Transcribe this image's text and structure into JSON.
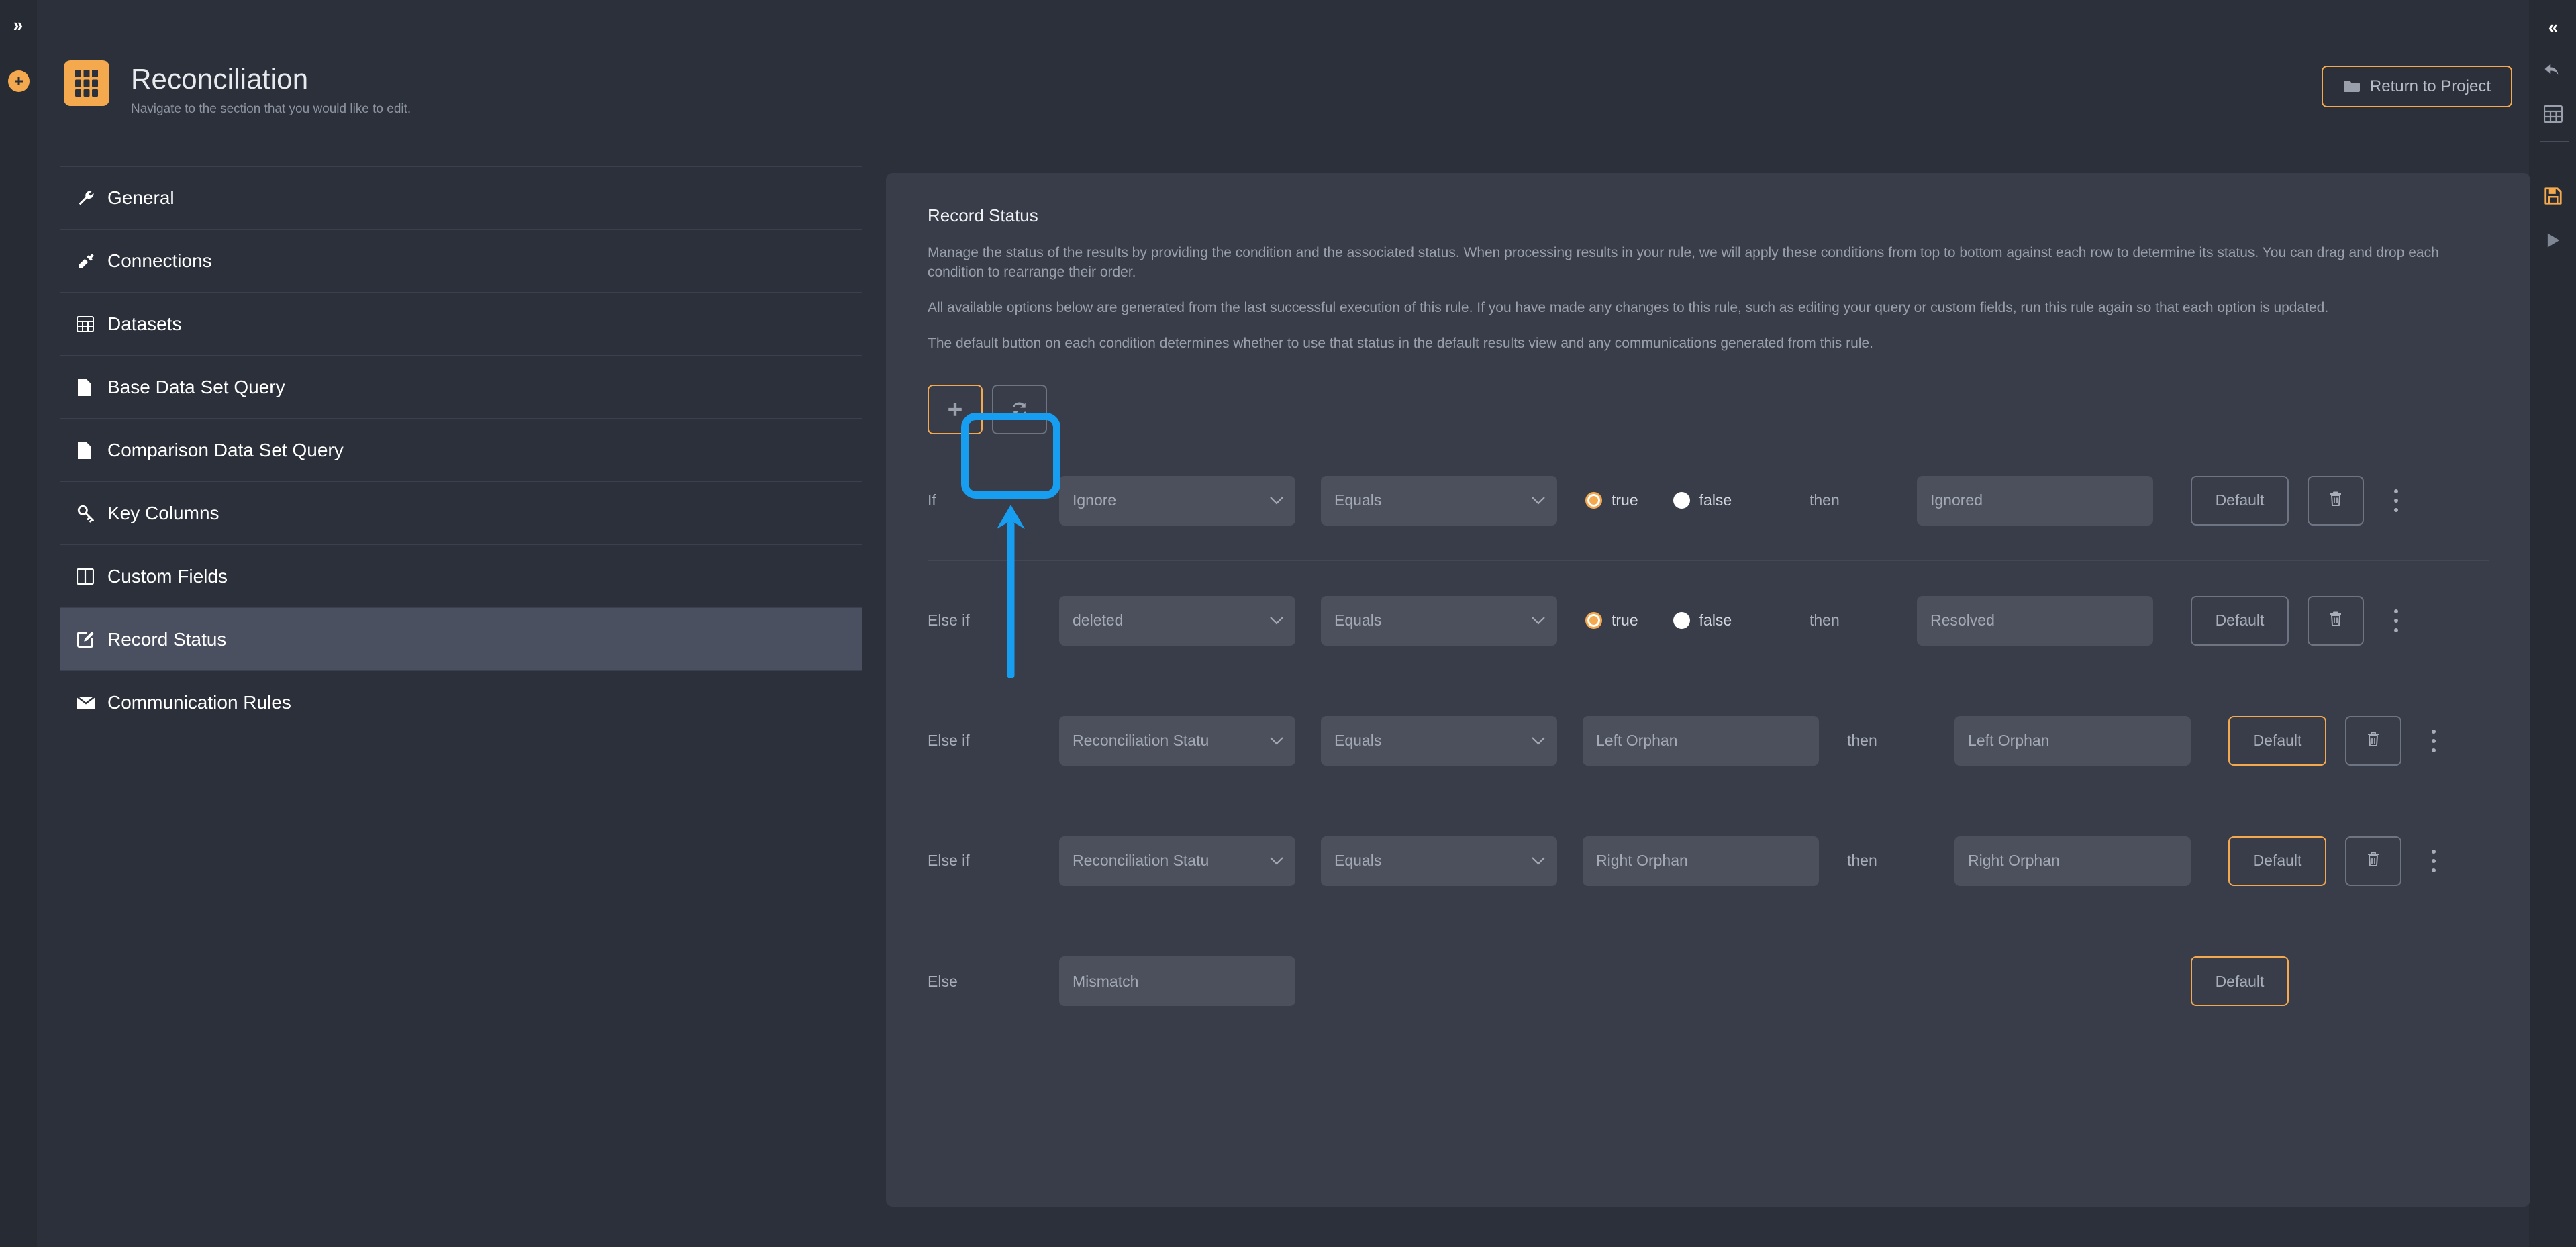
{
  "left_rail": {
    "expand_icon": "chevron-double-right-icon",
    "add_icon": "plus-circle-icon"
  },
  "right_rail": {
    "collapse_icon": "chevron-double-left-icon",
    "undo_icon": "undo-arrow-icon",
    "grid_icon": "table-grid-icon",
    "save_icon": "save-floppy-icon",
    "run_icon": "play-icon"
  },
  "header": {
    "logo_icon": "grid-app-icon",
    "title": "Reconciliation",
    "subtitle": "Navigate to the section that you would like to edit.",
    "return_button": {
      "label": "Return to Project",
      "icon": "folder-icon"
    }
  },
  "sidebar": {
    "items": [
      {
        "label": "General",
        "icon": "wrench-icon",
        "active": false
      },
      {
        "label": "Connections",
        "icon": "plug-icon",
        "active": false
      },
      {
        "label": "Datasets",
        "icon": "table-icon",
        "active": false
      },
      {
        "label": "Base Data Set Query",
        "icon": "file-icon",
        "active": false
      },
      {
        "label": "Comparison Data Set Query",
        "icon": "file-icon",
        "active": false
      },
      {
        "label": "Key Columns",
        "icon": "key-icon",
        "active": false
      },
      {
        "label": "Custom Fields",
        "icon": "columns-icon",
        "active": false
      },
      {
        "label": "Record Status",
        "icon": "edit-square-icon",
        "active": true
      },
      {
        "label": "Communication Rules",
        "icon": "envelope-icon",
        "active": false
      }
    ]
  },
  "panel": {
    "title": "Record Status",
    "description_1": "Manage the status of the results by providing the condition and the associated status. When processing results in your rule, we will apply these conditions from top to bottom against each row to determine its status. You can drag and drop each condition to rearrange their order.",
    "description_2": "All available options below are generated from the last successful execution of this rule. If you have made any changes to this rule, such as editing your query or custom fields, run this rule again so that each option is updated.",
    "description_3": "The default button on each condition determines whether to use that status in the default results view and any communications generated from this rule.",
    "toolbar": {
      "add_icon": "plus-icon",
      "refresh_icon": "refresh-icon"
    }
  },
  "rules": {
    "operator_label": "Equals",
    "then_label": "then",
    "default_label": "Default",
    "true_label": "true",
    "false_label": "false",
    "trash_icon": "trash-icon",
    "kebab_icon": "kebab-menu-icon",
    "rows": [
      {
        "keyword": "If",
        "field": "Ignore",
        "operator": "Equals",
        "value_type": "boolean",
        "value": "true",
        "then": "then",
        "status": "Ignored",
        "default_active": false
      },
      {
        "keyword": "Else if",
        "field": "deleted",
        "operator": "Equals",
        "value_type": "boolean",
        "value": "true",
        "then": "then",
        "status": "Resolved",
        "default_active": false
      },
      {
        "keyword": "Else if",
        "field": "Reconciliation Statu",
        "operator": "Equals",
        "value_type": "text",
        "value": "Left Orphan",
        "then": "then",
        "status": "Left Orphan",
        "default_active": true
      },
      {
        "keyword": "Else if",
        "field": "Reconciliation Statu",
        "operator": "Equals",
        "value_type": "text",
        "value": "Right Orphan",
        "then": "then",
        "status": "Right Orphan",
        "default_active": true
      }
    ],
    "else_row": {
      "keyword": "Else",
      "status": "Mismatch",
      "default_active": true
    }
  },
  "annotation": {
    "highlight_color": "#189ef0",
    "target": "refresh-button"
  },
  "colors": {
    "accent": "#f5a94e",
    "page_bg": "#2b303b",
    "panel_bg": "#383d49",
    "field_bg": "#4b505c",
    "annotation": "#189ef0"
  }
}
